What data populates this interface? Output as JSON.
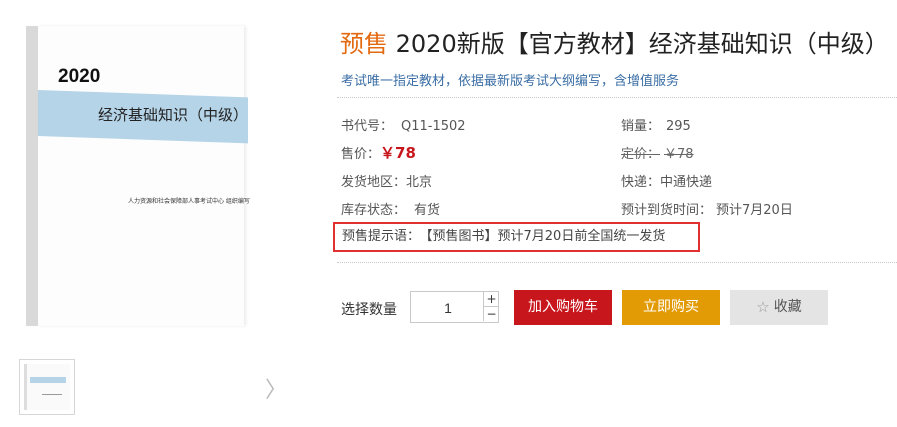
{
  "cover": {
    "year": "2020",
    "title": "经济基础知识（中级）",
    "publisher": "人力资源和社会保障部人事考试中心  组织编写"
  },
  "thumb": {
    "next_arrow": "〉"
  },
  "product": {
    "presale_tag": "预售",
    "title": " 2020新版【官方教材】经济基础知识（中级）",
    "subtitle": "考试唯一指定教材，依据最新版考试大纲编写，含增值服务"
  },
  "info": {
    "book_code_label": "书代号：",
    "book_code": "Q11-1502",
    "sales_label": "销量：",
    "sales": "295",
    "price_label": "售价：",
    "price": "￥78",
    "list_price_label": "定价：",
    "list_price": "￥78",
    "ship_region_label": "发货地区：",
    "ship_region": "北京",
    "courier_label": "快递：",
    "courier": "中通快递",
    "stock_label": "库存状态：",
    "stock": "有货",
    "arrival_label": "预计到货时间：",
    "arrival": "预计7月20日"
  },
  "notice": {
    "label": "预售提示语：",
    "text": "【预售图书】预计7月20日前全国统一发货"
  },
  "purchase": {
    "qty_label": "选择数量",
    "qty_value": "1",
    "plus": "+",
    "minus": "−",
    "add_cart": "加入购物车",
    "buy_now": "立即购买",
    "favorite": "收藏",
    "favorite_icon": "☆"
  }
}
